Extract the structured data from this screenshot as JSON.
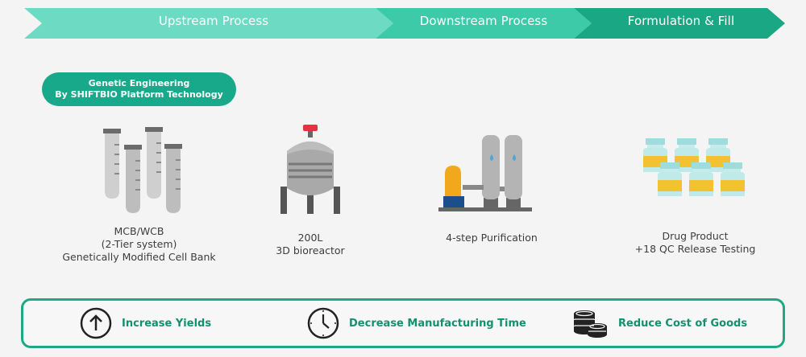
{
  "stages": [
    {
      "label": "Upstream Process",
      "color": "#6ddbc3"
    },
    {
      "label": "Downstream Process",
      "color": "#3dcaa9"
    },
    {
      "label": "Formulation & Fill",
      "color": "#1aa884"
    }
  ],
  "platform": {
    "line1": "Genetic Engineering",
    "line2": "By SHIFTBIO Platform Technology"
  },
  "steps": [
    {
      "icon": "test-tubes-icon",
      "lines": [
        "MCB/WCB",
        "(2-Tier system)",
        "Genetically Modified Cell Bank"
      ]
    },
    {
      "icon": "bioreactor-icon",
      "lines": [
        "200L",
        "3D bioreactor"
      ]
    },
    {
      "icon": "purification-system-icon",
      "lines": [
        "4-step Purification"
      ]
    },
    {
      "icon": "vials-icon",
      "lines": [
        "Drug Product",
        "+18 QC Release Testing"
      ]
    }
  ],
  "benefits": [
    {
      "icon": "arrow-up-icon",
      "label": "Increase Yields"
    },
    {
      "icon": "clock-icon",
      "label": "Decrease Manufacturing Time"
    },
    {
      "icon": "coins-icon",
      "label": "Reduce Cost of Goods"
    }
  ],
  "colors": {
    "accent": "#1aa884",
    "benefit_text": "#14906f"
  }
}
